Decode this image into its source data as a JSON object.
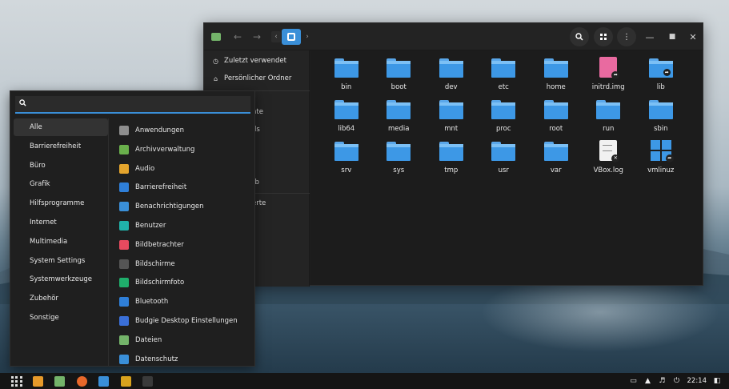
{
  "file_manager": {
    "sidebar": [
      {
        "label": "Zuletzt verwendet",
        "icon": "clock-icon"
      },
      {
        "label": "Persönlicher Ordner",
        "icon": "home-icon"
      }
    ],
    "sidebar_fragments": [
      "nte",
      "ds",
      "rb",
      "erte"
    ],
    "items": [
      {
        "label": "bin",
        "type": "folder"
      },
      {
        "label": "boot",
        "type": "folder"
      },
      {
        "label": "dev",
        "type": "folder"
      },
      {
        "label": "etc",
        "type": "folder"
      },
      {
        "label": "home",
        "type": "folder"
      },
      {
        "label": "initrd.img",
        "type": "image-link"
      },
      {
        "label": "lib",
        "type": "folder-link"
      },
      {
        "label": "lib64",
        "type": "folder"
      },
      {
        "label": "media",
        "type": "folder"
      },
      {
        "label": "mnt",
        "type": "folder"
      },
      {
        "label": "proc",
        "type": "folder"
      },
      {
        "label": "root",
        "type": "folder"
      },
      {
        "label": "run",
        "type": "folder"
      },
      {
        "label": "sbin",
        "type": "folder"
      },
      {
        "label": "srv",
        "type": "folder"
      },
      {
        "label": "sys",
        "type": "folder"
      },
      {
        "label": "tmp",
        "type": "folder"
      },
      {
        "label": "usr",
        "type": "folder"
      },
      {
        "label": "var",
        "type": "folder"
      },
      {
        "label": "VBox.log",
        "type": "text-file"
      },
      {
        "label": "vmlinuz",
        "type": "binary-link"
      }
    ]
  },
  "menu": {
    "search_placeholder": "",
    "categories": [
      "Alle",
      "Barrierefreiheit",
      "Büro",
      "Grafik",
      "Hilfsprogramme",
      "Internet",
      "Multimedia",
      "System Settings",
      "Systemwerkzeuge",
      "Zubehör",
      "Sonstige"
    ],
    "active_category": "Alle",
    "apps": [
      {
        "label": "Anwendungen",
        "icon": "gear-icon",
        "color": "#8e8e8e"
      },
      {
        "label": "Archivverwaltung",
        "icon": "archive-icon",
        "color": "#6ab04c"
      },
      {
        "label": "Audio",
        "icon": "audio-icon",
        "color": "#e5a52d"
      },
      {
        "label": "Barrierefreiheit",
        "icon": "accessibility-icon",
        "color": "#2f7fd8"
      },
      {
        "label": "Benachrichtigungen",
        "icon": "notifications-icon",
        "color": "#3a8fd8"
      },
      {
        "label": "Benutzer",
        "icon": "users-icon",
        "color": "#20b2aa"
      },
      {
        "label": "Bildbetrachter",
        "icon": "image-viewer-icon",
        "color": "#e84a5f"
      },
      {
        "label": "Bildschirme",
        "icon": "display-icon",
        "color": "#555555"
      },
      {
        "label": "Bildschirmfoto",
        "icon": "screenshot-icon",
        "color": "#1fae6b"
      },
      {
        "label": "Bluetooth",
        "icon": "bluetooth-icon",
        "color": "#2f7fd8"
      },
      {
        "label": "Budgie Desktop Einstellungen",
        "icon": "budgie-settings-icon",
        "color": "#3a6fd8"
      },
      {
        "label": "Dateien",
        "icon": "files-icon",
        "color": "#74b46a"
      },
      {
        "label": "Datenschutz",
        "icon": "privacy-icon",
        "color": "#3a8fd8"
      }
    ]
  },
  "taskbar": {
    "apps": [
      {
        "name": "software-installer-icon",
        "color": "#e79a2a"
      },
      {
        "name": "files-icon",
        "color": "#74b46a"
      },
      {
        "name": "firefox-icon",
        "color": "#e8682a"
      },
      {
        "name": "software-center-icon",
        "color": "#3a8fd8"
      },
      {
        "name": "settings-icon",
        "color": "#d9a21d"
      },
      {
        "name": "terminal-icon",
        "color": "#3a3a3a"
      }
    ],
    "clock": "22:14"
  }
}
